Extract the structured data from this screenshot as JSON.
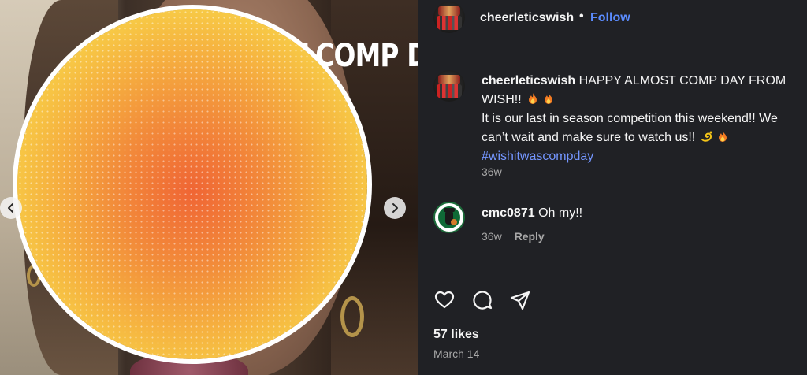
{
  "media": {
    "overlay_text": "ALMOST COMP DAY"
  },
  "header": {
    "username": "cheerleticswish",
    "separator": "•",
    "follow_label": "Follow"
  },
  "caption": {
    "username": "cheerleticswish",
    "line1": "HAPPY ALMOST COMP DAY FROM WISH!!",
    "line2": "It is our last in season competition this weekend!! We can’t wait and make sure to watch us!!",
    "hashtag": "#wishitwascompday",
    "age": "36w"
  },
  "comments": [
    {
      "username": "cmc0871",
      "text": "Oh my!!",
      "age": "36w",
      "reply_label": "Reply"
    }
  ],
  "actions": {
    "like_icon": "heart-icon",
    "comment_icon": "comment-icon",
    "share_icon": "share-icon"
  },
  "stats": {
    "likes": "57 likes",
    "date": "March 14"
  },
  "colors": {
    "panel_bg": "#202125",
    "link_blue": "#5b8cff",
    "hashtag_blue": "#7496ff",
    "muted_text": "#a8a8a8"
  }
}
